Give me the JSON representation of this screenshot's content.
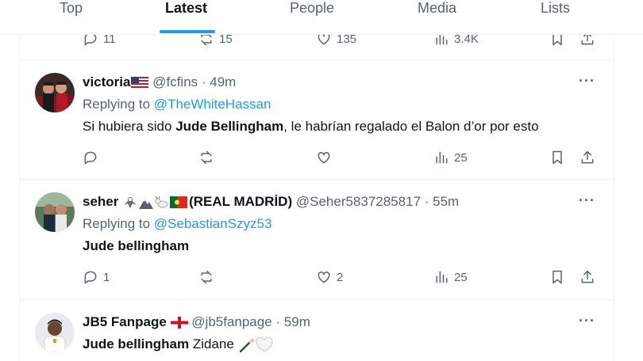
{
  "tabs": [
    {
      "label": "Top"
    },
    {
      "label": "Latest"
    },
    {
      "label": "People"
    },
    {
      "label": "Media"
    },
    {
      "label": "Lists"
    }
  ],
  "prev_tweet_actions": {
    "replies": "11",
    "retweets": "15",
    "likes": "135",
    "views": "3.4K"
  },
  "tweets": [
    {
      "display_name": "victoria",
      "handle": "@fcfins",
      "time": "· 49m",
      "replying_prefix": "Replying to",
      "replying_to": "@TheWhiteHassan",
      "text_pre": "Si hubiera sido ",
      "text_bold": "Jude Bellingham",
      "text_post": ", le habrían regalado el Balon d’or por esto",
      "replies": "",
      "retweets": "",
      "likes": "",
      "views": "25"
    },
    {
      "display_name": "seher",
      "display_name_suffix": "(REAL MADRİD)",
      "handle": "@Seher5837285817",
      "time": "· 55m",
      "replying_prefix": "Replying to",
      "replying_to": "@SebastianSzyz53",
      "text_bold": "Jude bellingham",
      "replies": "1",
      "retweets": "",
      "likes": "2",
      "views": "25"
    },
    {
      "display_name": "JB5 Fanpage",
      "handle": "@jb5fanpage",
      "time": "· 59m",
      "text_bold": "Jude bellingham",
      "text_post": " Zidane"
    }
  ],
  "more_label": "···",
  "colors": {
    "accent": "#1d9bf0",
    "muted": "#536471",
    "text": "#0f1419"
  }
}
